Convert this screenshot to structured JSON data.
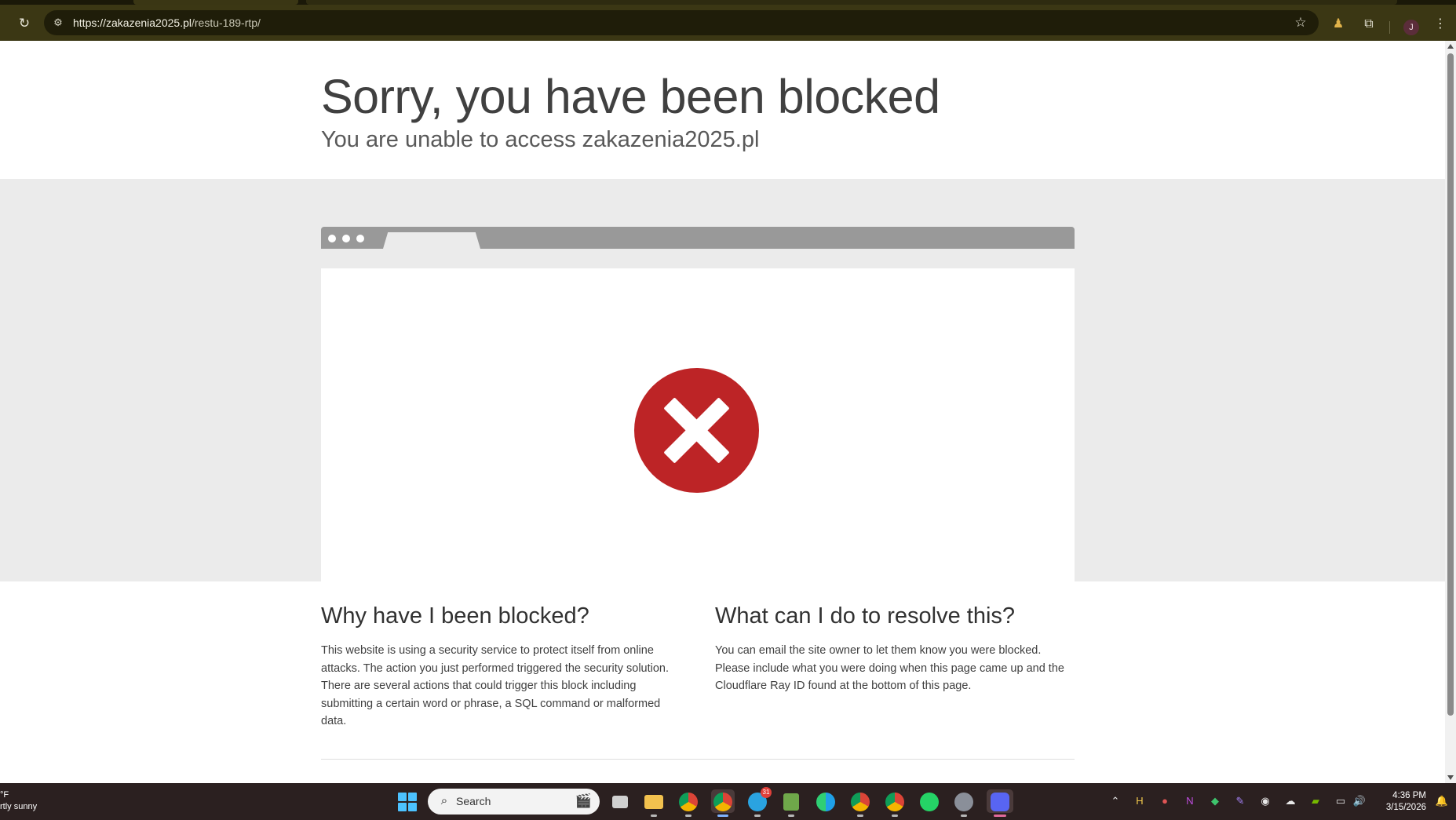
{
  "browser": {
    "url_host": "https://zakazenia2025.pl",
    "url_path": "/restu-189-rtp/",
    "reload_icon": "reload-icon",
    "site_info_icon": "tune-icon",
    "star_icon": "star-icon",
    "profile_initial": "J"
  },
  "page": {
    "title": "Sorry, you have been blocked",
    "subtitle": "You are unable to access zakazenia2025.pl",
    "why_heading": "Why have I been blocked?",
    "why_text": "This website is using a security service to protect itself from online attacks. The action you just performed triggered the security solution. There are several actions that could trigger this block including submitting a certain word or phrase, a SQL command or malformed data.",
    "resolve_heading": "What can I do to resolve this?",
    "resolve_text": "You can email the site owner to let them know you were blocked. Please include what you were doing when this page came up and the Cloudflare Ray ID found at the bottom of this page.",
    "error_color": "#bd2426"
  },
  "taskbar": {
    "weather_temp": "°F",
    "weather_desc": "rtly sunny",
    "search_placeholder": "Search",
    "telegram_badge": "31",
    "time": "4:36 PM",
    "date": "3/15/2026"
  }
}
